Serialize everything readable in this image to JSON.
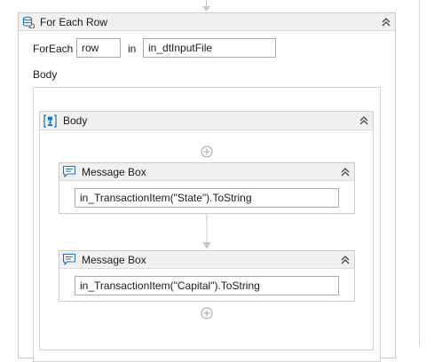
{
  "foreach": {
    "title": "For Each Row",
    "foreach_label": "ForEach",
    "item_value": "row",
    "in_label": "in",
    "collection_value": "in_dtInputFile",
    "body_label": "Body"
  },
  "sequence": {
    "title": "Body"
  },
  "activities": [
    {
      "title": "Message Box",
      "text_value": "in_TransactionItem(\"State\").ToString"
    },
    {
      "title": "Message Box",
      "text_value": "in_TransactionItem(\"Capital\").ToString"
    }
  ],
  "colors": {
    "header_bg": "#f0f0f0",
    "border": "#c9c9c9",
    "icon_blue": "#1f6fb4",
    "connector": "#c8c8c8"
  },
  "icons": {
    "foreach": "database-loop-icon",
    "sequence": "sequence-icon",
    "message_box": "message-box-icon",
    "collapse": "double-chevron-up-icon",
    "add": "plus-circle-icon"
  }
}
